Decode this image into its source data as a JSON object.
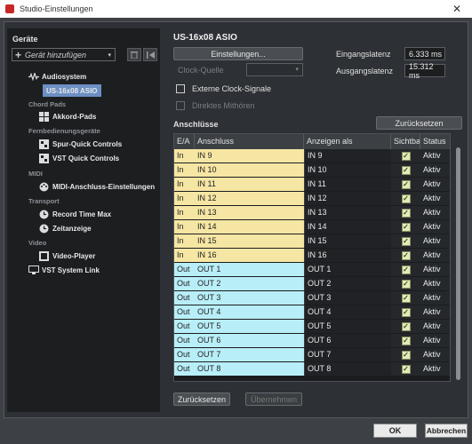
{
  "window": {
    "title": "Studio-Einstellungen",
    "close_glyph": "✕"
  },
  "left": {
    "heading": "Geräte",
    "add_label": "Gerät hinzufügen",
    "tree": {
      "audio": "Audiosystem",
      "audio_device": "US-16x08 ASIO",
      "cat_chord": "Chord Pads",
      "chord": "Akkord-Pads",
      "cat_remote": "Fernbedienungsgeräte",
      "track_qc": "Spur-Quick Controls",
      "vst_qc": "VST Quick Controls",
      "cat_midi": "MIDI",
      "midi_port": "MIDI-Anschluss-Einstellungen",
      "cat_transport": "Transport",
      "record_time": "Record Time Max",
      "time_display": "Zeitanzeige",
      "cat_video": "Video",
      "video_player": "Video-Player",
      "vst_link": "VST System Link"
    }
  },
  "main": {
    "title": "US-16x08 ASIO",
    "settings_button": "Einstellungen...",
    "clock_source_label": "Clock-Quelle",
    "external_clock": "Externe Clock-Signale",
    "direct_monitoring": "Direktes Mithören",
    "input_latency_label": "Eingangslatenz",
    "input_latency": "6.333 ms",
    "output_latency_label": "Ausgangslatenz",
    "output_latency": "15.312 ms",
    "ports_label": "Anschlüsse",
    "reset_top": "Zurücksetzen",
    "columns": [
      "E/A",
      "Anschluss",
      "Anzeigen als",
      "Sichtbar",
      "Status"
    ],
    "rows": [
      {
        "io": "In",
        "port": "IN 9",
        "show": "IN 9",
        "visible": true,
        "status": "Aktiv"
      },
      {
        "io": "In",
        "port": "IN 10",
        "show": "IN 10",
        "visible": true,
        "status": "Aktiv"
      },
      {
        "io": "In",
        "port": "IN 11",
        "show": "IN 11",
        "visible": true,
        "status": "Aktiv"
      },
      {
        "io": "In",
        "port": "IN 12",
        "show": "IN 12",
        "visible": true,
        "status": "Aktiv"
      },
      {
        "io": "In",
        "port": "IN 13",
        "show": "IN 13",
        "visible": true,
        "status": "Aktiv"
      },
      {
        "io": "In",
        "port": "IN 14",
        "show": "IN 14",
        "visible": true,
        "status": "Aktiv"
      },
      {
        "io": "In",
        "port": "IN 15",
        "show": "IN 15",
        "visible": true,
        "status": "Aktiv"
      },
      {
        "io": "In",
        "port": "IN 16",
        "show": "IN 16",
        "visible": true,
        "status": "Aktiv"
      },
      {
        "io": "Out",
        "port": "OUT 1",
        "show": "OUT 1",
        "visible": true,
        "status": "Aktiv"
      },
      {
        "io": "Out",
        "port": "OUT 2",
        "show": "OUT 2",
        "visible": true,
        "status": "Aktiv"
      },
      {
        "io": "Out",
        "port": "OUT 3",
        "show": "OUT 3",
        "visible": true,
        "status": "Aktiv"
      },
      {
        "io": "Out",
        "port": "OUT 4",
        "show": "OUT 4",
        "visible": true,
        "status": "Aktiv"
      },
      {
        "io": "Out",
        "port": "OUT 5",
        "show": "OUT 5",
        "visible": true,
        "status": "Aktiv"
      },
      {
        "io": "Out",
        "port": "OUT 6",
        "show": "OUT 6",
        "visible": true,
        "status": "Aktiv"
      },
      {
        "io": "Out",
        "port": "OUT 7",
        "show": "OUT 7",
        "visible": true,
        "status": "Aktiv"
      },
      {
        "io": "Out",
        "port": "OUT 8",
        "show": "OUT 8",
        "visible": true,
        "status": "Aktiv"
      }
    ],
    "reset_bottom": "Zurücksetzen",
    "apply": "Übernehmen"
  },
  "footer": {
    "ok": "OK",
    "cancel": "Abbrechen"
  },
  "icons": {
    "plus": "+",
    "dropdown": "▾",
    "check": "✓"
  }
}
